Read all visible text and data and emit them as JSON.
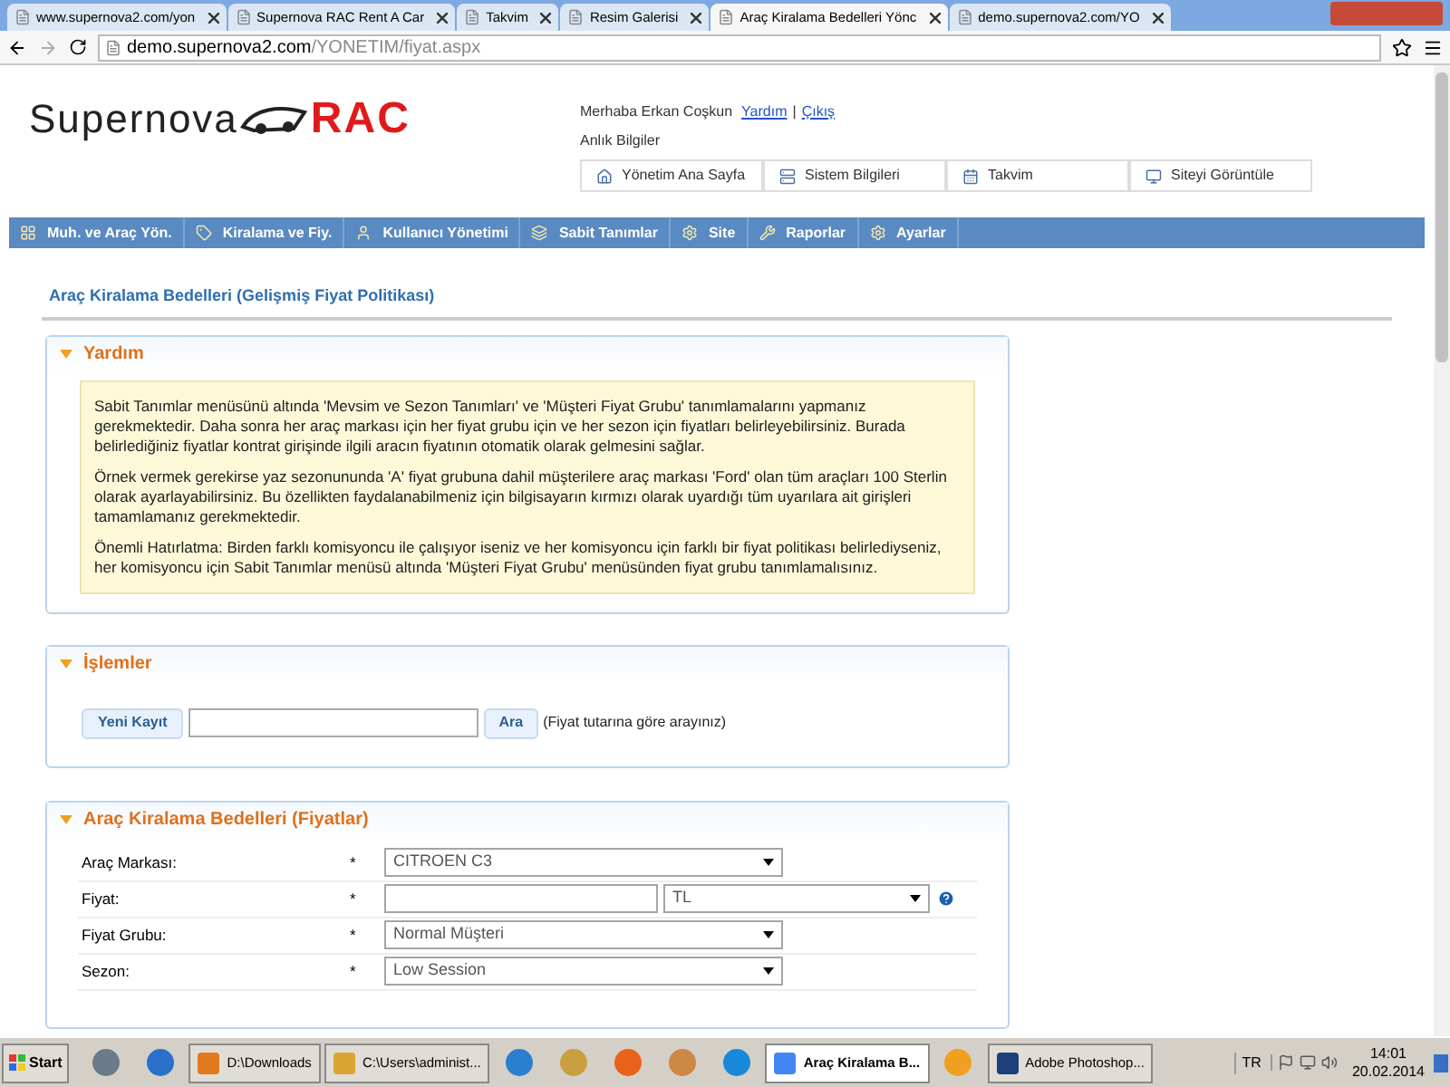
{
  "browser": {
    "tabs": [
      {
        "title": "www.supernova2.com/yon",
        "selected": false
      },
      {
        "title": "Supernova RAC Rent A Car",
        "selected": false
      },
      {
        "title": "Takvim",
        "selected": false
      },
      {
        "title": "Resim Galerisi",
        "selected": false
      },
      {
        "title": "Araç Kiralama Bedelleri Yönc",
        "selected": true
      },
      {
        "title": "demo.supernova2.com/YO",
        "selected": false
      }
    ],
    "url": {
      "host": "demo.supernova2.com",
      "path": "/YONETIM/fiyat.aspx"
    }
  },
  "header": {
    "logo": {
      "name": "Supernova",
      "accent": "RAC"
    },
    "greeting": "Merhaba Erkan Coşkun",
    "links": [
      "Yardım",
      "Çıkış"
    ],
    "separator": "|",
    "info_title": "Anlık Bilgiler",
    "quick_links": [
      {
        "label": "Yönetim Ana Sayfa"
      },
      {
        "label": "Sistem Bilgileri"
      },
      {
        "label": "Takvim"
      },
      {
        "label": "Siteyi Görüntüle"
      }
    ]
  },
  "nav": {
    "items": [
      {
        "label": "Muh. ve Araç Yön."
      },
      {
        "label": "Kiralama ve Fiy."
      },
      {
        "label": "Kullanıcı Yönetimi"
      },
      {
        "label": "Sabit Tanımlar"
      },
      {
        "label": "Site"
      },
      {
        "label": "Raporlar"
      },
      {
        "label": "Ayarlar"
      }
    ]
  },
  "page_title": "Araç Kiralama Bedelleri (Gelişmiş Fiyat Politikası)",
  "help": {
    "title": "Yardım",
    "expanded": true,
    "paragraphs": [
      "Sabit Tanımlar menüsünü altında 'Mevsim ve Sezon Tanımları' ve 'Müşteri Fiyat Grubu' tanımlamalarını yapmanız gerekmektedir. Daha sonra her araç markası için her fiyat grubu için ve her sezon için fiyatları belirleyebilirsiniz. Burada belirlediğiniz fiyatlar kontrat girişinde ilgili aracın fiyatının otomatik olarak gelmesini sağlar.",
      "Örnek vermek gerekirse yaz sezonununda 'A' fiyat grubuna dahil müşterilere araç markası 'Ford' olan tüm araçları 100 Sterlin olarak ayarlayabilirsiniz. Bu özellikten faydalanabilmeniz için bilgisayarın kırmızı olarak uyardığı tüm uyarılara ait girişleri tamamlamanız gerekmektedir.",
      "Önemli Hatırlatma: Birden farklı komisyoncu ile çalışıyor iseniz ve her komisyoncu için farklı bir fiyat politikası belirlediyseniz, her komisyoncu için Sabit Tanımlar menüsü altında  'Müşteri Fiyat Grubu' menüsünden fiyat grubu tanımlamalısınız."
    ]
  },
  "actions": {
    "title": "İşlemler",
    "expanded": true,
    "new_button": "Yeni Kayıt",
    "search_button": "Ara",
    "hint": "(Fiyat tutarına göre arayınız)"
  },
  "prices": {
    "title": "Araç Kiralama Bedelleri (Fiyatlar)",
    "expanded": true,
    "fields": [
      {
        "kind": "select",
        "label": "Araç Markası:",
        "required": "*",
        "value": "CITROEN C3"
      },
      {
        "kind": "price",
        "label": "Fiyat:",
        "required": "*",
        "currency": "TL"
      },
      {
        "kind": "select",
        "label": "Fiyat Grubu:",
        "required": "*",
        "value": "Normal Müşteri"
      },
      {
        "kind": "select",
        "label": "Sezon:",
        "required": "*",
        "value": "Low Session"
      }
    ]
  },
  "taskbar": {
    "start": "Start",
    "items": [
      {
        "kind": "icon",
        "selected": false
      },
      {
        "kind": "icon",
        "selected": false
      },
      {
        "kind": "window",
        "label": "D:\\Downloads",
        "selected": false
      },
      {
        "kind": "window",
        "label": "C:\\Users\\administ...",
        "selected": false
      },
      {
        "kind": "icon",
        "selected": false
      },
      {
        "kind": "icon",
        "selected": false
      },
      {
        "kind": "icon",
        "selected": false
      },
      {
        "kind": "icon",
        "selected": false
      },
      {
        "kind": "icon",
        "selected": false
      },
      {
        "kind": "window",
        "label": "Araç Kiralama B...",
        "selected": true
      },
      {
        "kind": "icon",
        "selected": false
      },
      {
        "kind": "window",
        "label": "Adobe Photoshop...",
        "selected": false
      }
    ],
    "language": "TR",
    "time": "14:01",
    "date": "20.02.2014"
  }
}
